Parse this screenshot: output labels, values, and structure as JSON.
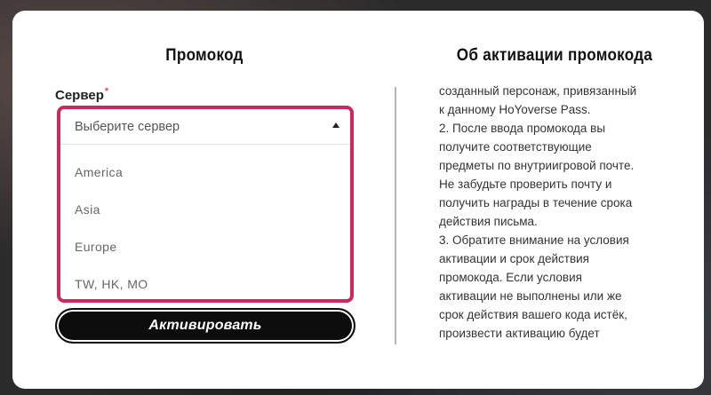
{
  "left": {
    "title": "Промокод",
    "server_label": "Сервер",
    "required_mark": "*",
    "dropdown": {
      "placeholder": "Выберите сервер",
      "options": [
        "America",
        "Asia",
        "Europe",
        "TW, HK, MO"
      ]
    },
    "activate_label": "Активировать"
  },
  "right": {
    "title": "Об активации промокода",
    "lines": [
      "созданный персонаж, привязанный",
      "к данному HoYoverse Pass.",
      "2. После ввода промокода вы",
      "получите соответствующие",
      "предметы по внутриигровой почте.",
      "Не забудьте проверить почту и",
      "получить награды в течение срока",
      "действия письма.",
      "3. Обратите внимание на условия",
      "активации и срок действия",
      "промокода. Если условия",
      "активации не выполнены или же",
      "срок действия вашего кода истёк,",
      "произвести активацию будет"
    ]
  },
  "colors": {
    "accent": "#cc2a5e",
    "button_bg": "#0d0d0d",
    "required": "#d24a58"
  },
  "icons": {
    "dropdown_caret": "caret-up-icon"
  }
}
